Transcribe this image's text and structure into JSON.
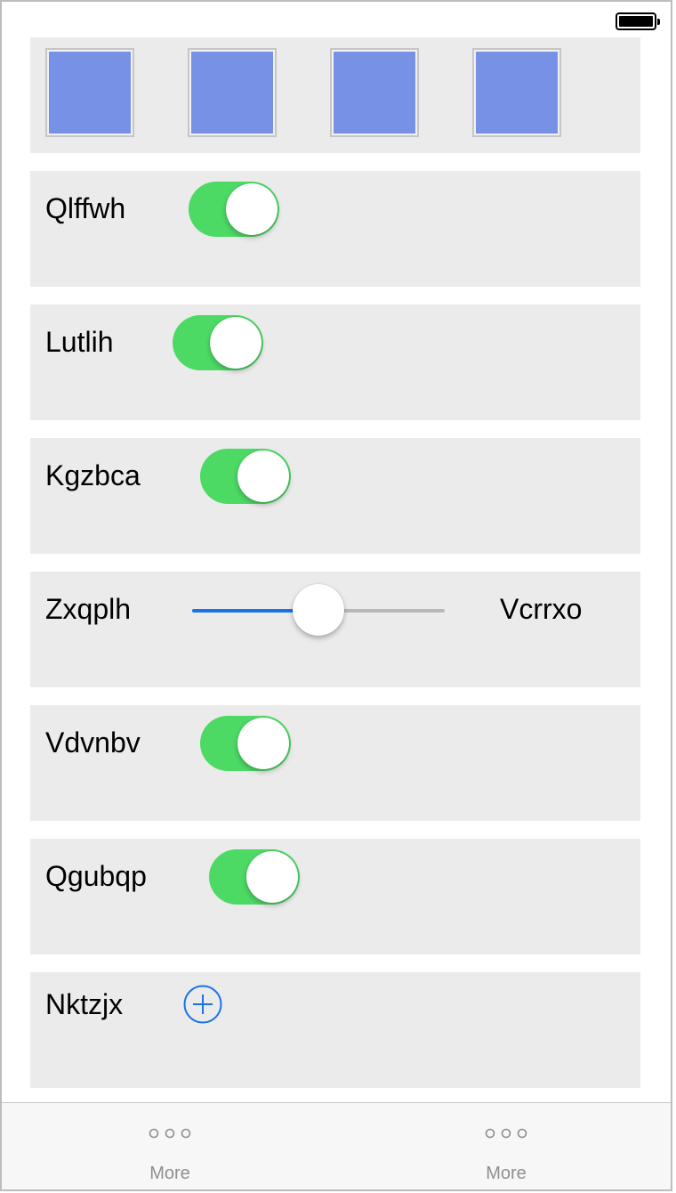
{
  "status_bar": {
    "battery_icon": "battery-full-icon"
  },
  "thumbnails": {
    "color": "#7791e6",
    "count": 4
  },
  "rows": [
    {
      "label": "Qlffwh",
      "control": "toggle",
      "on": true
    },
    {
      "label": "Lutlih",
      "control": "toggle",
      "on": true
    },
    {
      "label": "Kgzbca",
      "control": "toggle",
      "on": true
    },
    {
      "label": "Zxqplh",
      "control": "slider",
      "value": 0.5,
      "right_label": "Vcrrxo"
    },
    {
      "label": "Vdvnbv",
      "control": "toggle",
      "on": true
    },
    {
      "label": "Qgubqp",
      "control": "toggle",
      "on": true
    },
    {
      "label": "Nktzjx",
      "control": "add-button",
      "icon": "plus-circle-icon"
    }
  ],
  "tabbar": {
    "tabs": [
      {
        "label": "More",
        "icon": "more-dots-icon"
      },
      {
        "label": "More",
        "icon": "more-dots-icon"
      }
    ]
  },
  "colors": {
    "toggle_on": "#4cd964",
    "slider_fill": "#1a73e8",
    "accent": "#1a73e8",
    "card_bg": "#ebebeb"
  }
}
